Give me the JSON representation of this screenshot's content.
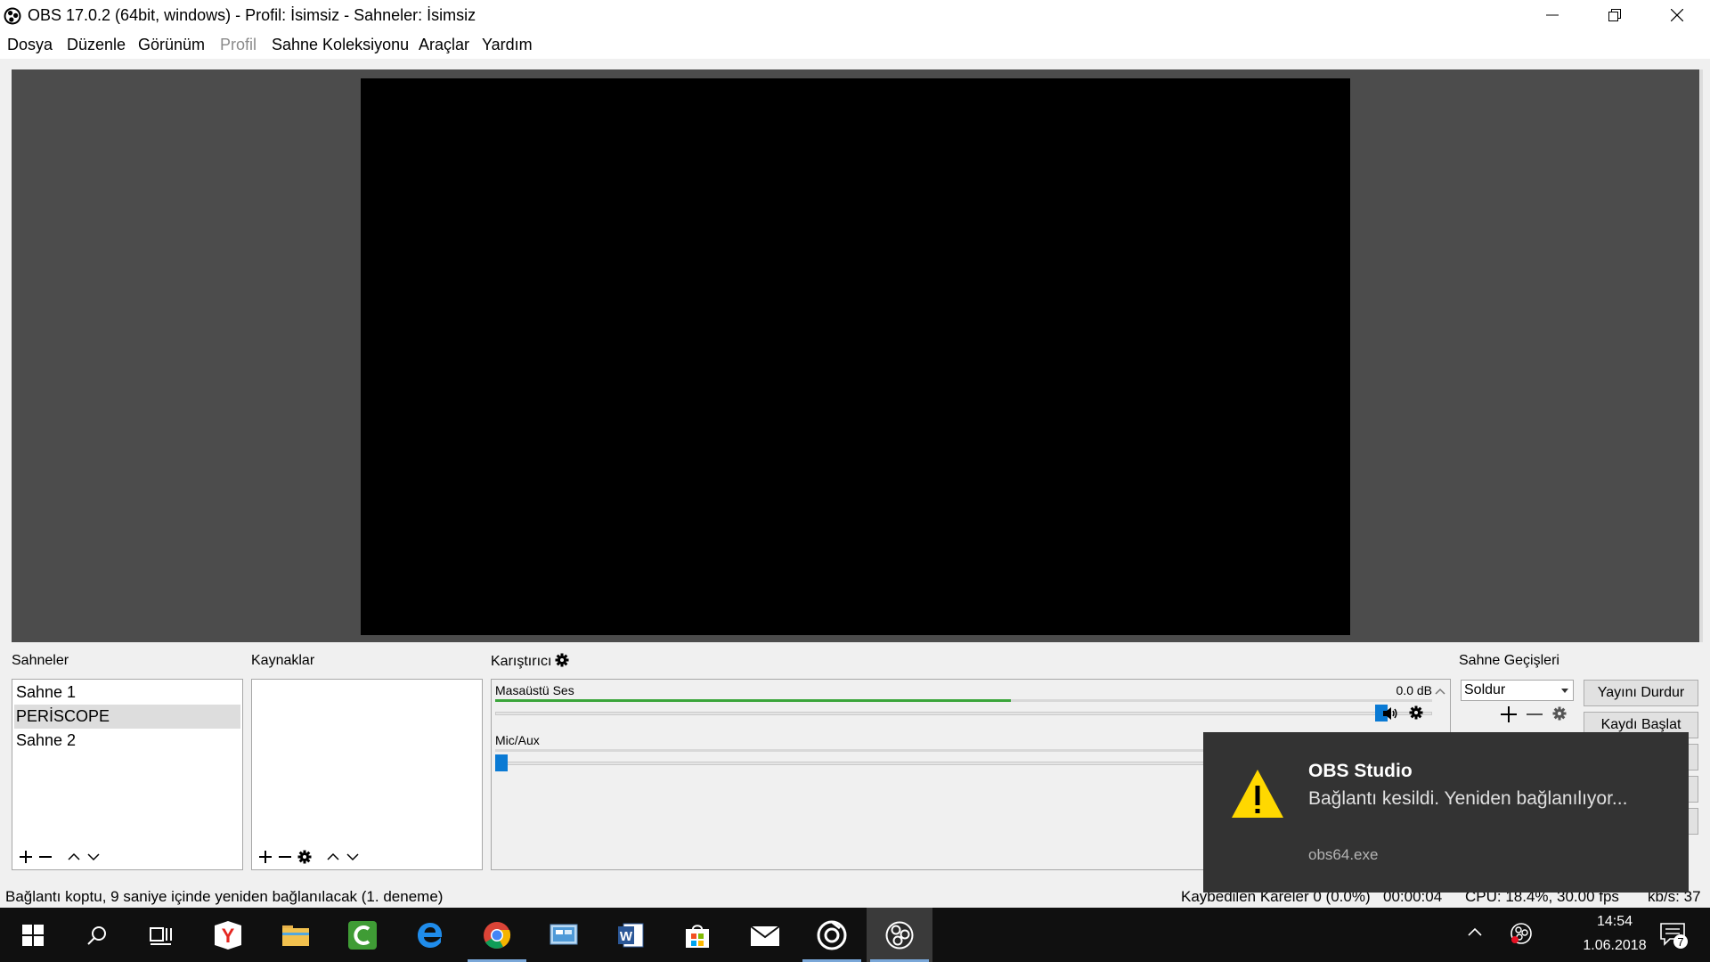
{
  "window": {
    "title": "OBS 17.0.2 (64bit, windows) - Profil: İsimsiz - Sahneler: İsimsiz"
  },
  "menu": {
    "items": [
      "Dosya",
      "Düzenle",
      "Görünüm",
      "Profil",
      "Sahne Koleksiyonu",
      "Araçlar",
      "Yardım"
    ]
  },
  "docks": {
    "scenes": {
      "title": "Sahneler",
      "items": [
        "Sahne 1",
        "PERİSCOPE",
        "Sahne 2"
      ],
      "selected_index": 1
    },
    "sources": {
      "title": "Kaynaklar"
    },
    "mixer": {
      "title": "Karıştırıcı",
      "channels": [
        {
          "name": "Masaüstü Ses",
          "db": "0.0 dB",
          "level": 0.55,
          "volume": 1.0
        },
        {
          "name": "Mic/Aux",
          "level": 0.0,
          "volume": 0.0
        }
      ]
    },
    "transitions": {
      "title": "Sahne Geçişleri",
      "selected": "Soldur"
    }
  },
  "controls": {
    "stop_stream": "Yayını Durdur",
    "start_record": "Kaydı Başlat"
  },
  "status": {
    "message": "Bağlantı koptu, 9 saniye içinde yeniden bağlanılacak (1. deneme)",
    "dropped_frames": "Kaybedilen Kareler 0 (0.0%)",
    "time": "00:00:04",
    "cpu": "CPU: 18.4%, 30.00 fps",
    "kbps": "kb/s: 37"
  },
  "notification": {
    "title": "OBS Studio",
    "body": "Bağlantı kesildi.  Yeniden bağlanılıyor...",
    "app": "obs64.exe"
  },
  "taskbar": {
    "time": "14:54",
    "date": "1.06.2018",
    "notification_count": "7"
  },
  "colors": {
    "preview_frame": "#4c4c4c",
    "meter_green": "#3ba53b",
    "slider_blue": "#0a7ad4",
    "toast_bg": "#333333",
    "warning_yellow": "#ffd800"
  }
}
